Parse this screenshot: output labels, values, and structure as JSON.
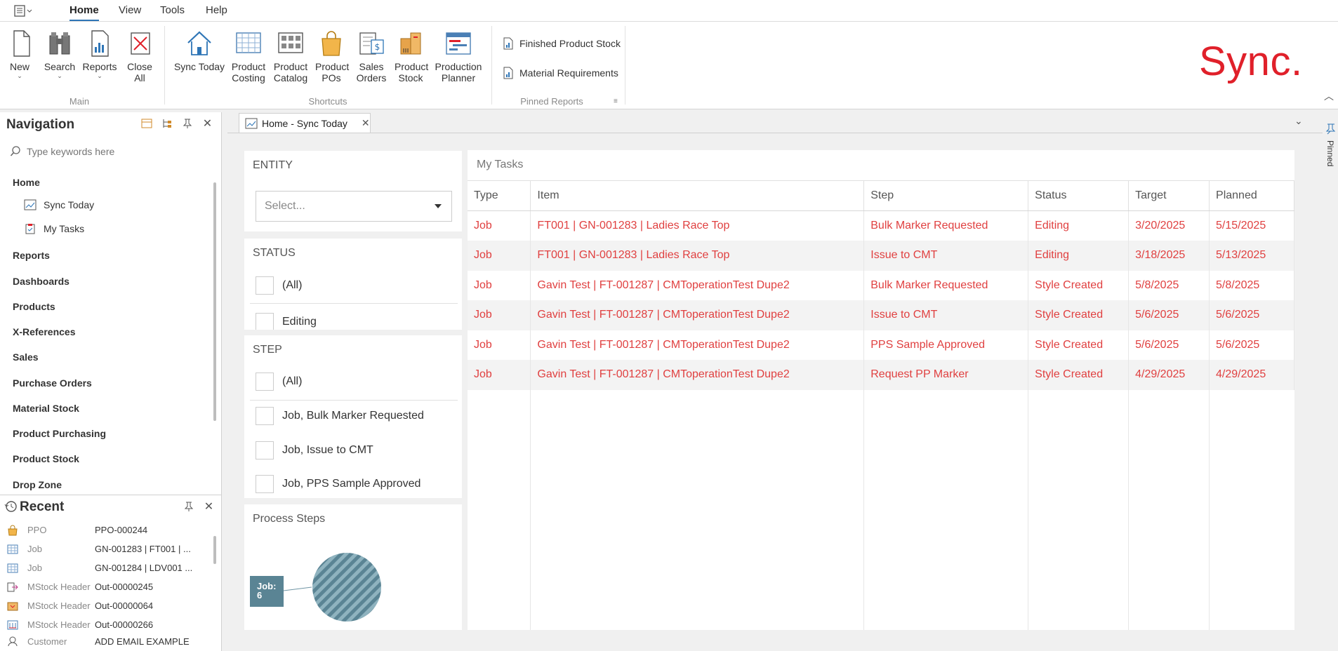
{
  "menubar": {
    "tabs": [
      {
        "label": "Home",
        "active": true
      },
      {
        "label": "View",
        "active": false
      },
      {
        "label": "Tools",
        "active": false
      },
      {
        "label": "Help",
        "active": false
      }
    ]
  },
  "ribbon": {
    "main": {
      "label": "Main",
      "buttons": [
        "New",
        "Search",
        "Reports",
        "Close All"
      ]
    },
    "shortcuts": {
      "label": "Shortcuts",
      "buttons": [
        "Sync Today",
        "Product Costing",
        "Product Catalog",
        "Product POs",
        "Sales Orders",
        "Product Stock",
        "Production Planner"
      ]
    },
    "pinned_reports": {
      "label": "Pinned Reports",
      "items": [
        "Finished Product Stock",
        "Material Requirements"
      ]
    },
    "logo_text": "Sync.",
    "accent_color": "#e0202a"
  },
  "navigation": {
    "title": "Navigation",
    "search_placeholder": "Type keywords here",
    "sections": [
      "Home",
      "Reports",
      "Dashboards",
      "Products",
      "X-References",
      "Sales",
      "Purchase Orders",
      "Material Stock",
      "Product Purchasing",
      "Product Stock",
      "Drop Zone"
    ],
    "home_items": [
      "Sync Today",
      "My Tasks"
    ]
  },
  "recent": {
    "title": "Recent",
    "rows": [
      {
        "type": "PPO",
        "value": "PPO-000244",
        "icon": "bag-icon"
      },
      {
        "type": "Job",
        "value": "GN-001283 | FT001 | ...",
        "icon": "grid-icon"
      },
      {
        "type": "Job",
        "value": "GN-001284 | LDV001 ...",
        "icon": "grid-icon"
      },
      {
        "type": "MStock Header",
        "value": "Out-00000245",
        "icon": "stock-out-icon"
      },
      {
        "type": "MStock Header",
        "value": "Out-00000064",
        "icon": "stock-box-icon"
      },
      {
        "type": "MStock Header",
        "value": "Out-00000266",
        "icon": "stock-grid-icon"
      },
      {
        "type": "Customer",
        "value": "ADD EMAIL EXAMPLE",
        "icon": "customer-icon"
      }
    ]
  },
  "document": {
    "tab_label": "Home - Sync Today",
    "side_label": "Pinned"
  },
  "filters": {
    "entity": {
      "title": "ENTITY",
      "placeholder": "Select..."
    },
    "status": {
      "title": "STATUS",
      "options": [
        "(All)",
        "Editing"
      ]
    },
    "step": {
      "title": "STEP",
      "options": [
        "(All)",
        "Job, Bulk Marker Requested",
        "Job, Issue to CMT",
        "Job, PPS Sample Approved"
      ]
    },
    "process_steps": {
      "title": "Process Steps",
      "node_label": "Job:",
      "node_count": "6"
    }
  },
  "tasks": {
    "title": "My Tasks",
    "columns": [
      "Type",
      "Item",
      "Step",
      "Status",
      "Target",
      "Planned"
    ],
    "rows": [
      [
        "Job",
        "FT001 | GN-001283 | Ladies Race Top",
        "Bulk Marker Requested",
        "Editing",
        "3/20/2025",
        "5/15/2025"
      ],
      [
        "Job",
        "FT001 | GN-001283 | Ladies Race Top",
        "Issue to CMT",
        "Editing",
        "3/18/2025",
        "5/13/2025"
      ],
      [
        "Job",
        "Gavin Test | FT-001287 | CMToperationTest Dupe2",
        "Bulk Marker Requested",
        "Style Created",
        "5/8/2025",
        "5/8/2025"
      ],
      [
        "Job",
        "Gavin Test | FT-001287 | CMToperationTest Dupe2",
        "Issue to CMT",
        "Style Created",
        "5/6/2025",
        "5/6/2025"
      ],
      [
        "Job",
        "Gavin Test | FT-001287 | CMToperationTest Dupe2",
        "PPS Sample Approved",
        "Style Created",
        "5/6/2025",
        "5/6/2025"
      ],
      [
        "Job",
        "Gavin Test | FT-001287 | CMToperationTest Dupe2",
        "Request PP Marker",
        "Style Created",
        "4/29/2025",
        "4/29/2025"
      ]
    ],
    "row_color": "#e04040"
  }
}
